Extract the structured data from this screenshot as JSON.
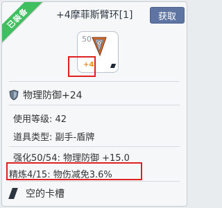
{
  "badge": {
    "equipped": "已装备"
  },
  "item": {
    "name": "+4摩菲斯臂环[1]",
    "level_number": "50",
    "refine_label": "+4"
  },
  "actions": {
    "get_label": "获取"
  },
  "main_stat": {
    "label": "物理防御+24"
  },
  "details": {
    "use_level": "使用等级: 42",
    "item_type": "道具类型: 副手-盾牌",
    "enhance": "强化50/54: 物理防御 +15.0",
    "refine": "精炼4/15: 物伤减免3.6%"
  },
  "card_slot": {
    "label": "空的卡槽"
  },
  "colors": {
    "ribbon": "#3fbf5f",
    "button": "#5e75a3",
    "highlight": "#e02020",
    "refine_text": "#f08a24"
  }
}
